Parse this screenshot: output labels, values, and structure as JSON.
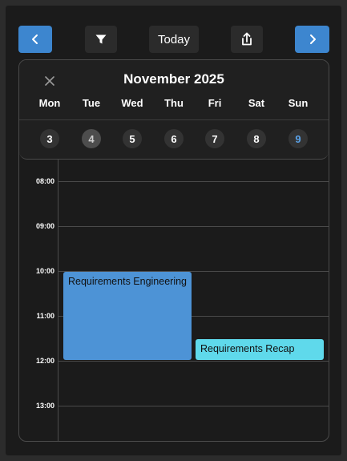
{
  "toolbar": {
    "prev_icon": "chevron-left-icon",
    "filter_icon": "filter-icon",
    "today_label": "Today",
    "share_icon": "share-icon",
    "next_icon": "chevron-right-icon"
  },
  "calendar": {
    "close_icon": "close-icon",
    "title": "November 2025",
    "weekdays": [
      "Mon",
      "Tue",
      "Wed",
      "Thu",
      "Fri",
      "Sat",
      "Sun"
    ],
    "days": [
      {
        "num": "3",
        "state": "normal"
      },
      {
        "num": "4",
        "state": "today"
      },
      {
        "num": "5",
        "state": "normal"
      },
      {
        "num": "6",
        "state": "normal"
      },
      {
        "num": "7",
        "state": "normal"
      },
      {
        "num": "8",
        "state": "normal"
      },
      {
        "num": "9",
        "state": "selected"
      }
    ],
    "hours": [
      "08:00",
      "09:00",
      "10:00",
      "11:00",
      "12:00",
      "13:00"
    ],
    "events": [
      {
        "title": "Requirements Engineering",
        "start": "10:00",
        "end": "12:00"
      },
      {
        "title": "Requirements Recap",
        "start": "11:30",
        "end": "12:00"
      }
    ]
  },
  "colors": {
    "accent": "#3d86cf",
    "event_primary": "#4d93d6",
    "event_secondary": "#5fd9eb",
    "selected_day": "#5aa2e8"
  }
}
